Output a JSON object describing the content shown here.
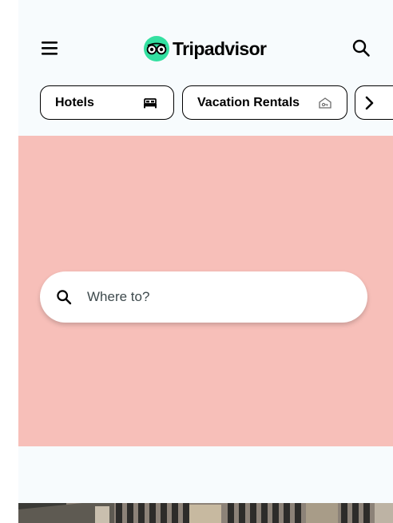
{
  "header": {
    "menu_icon": "hamburger-menu-icon",
    "brand_icon": "owl-eyes-logo-icon",
    "brand_name": "Tripadvisor",
    "search_icon": "search-icon"
  },
  "categories": [
    {
      "label": "Hotels",
      "icon": "bed-icon"
    },
    {
      "label": "Vacation Rentals",
      "icon": "house-key-icon"
    },
    {
      "label": "",
      "icon": "chevron-right-icon"
    }
  ],
  "hero": {
    "search_placeholder": "Where to?",
    "search_icon": "search-icon"
  },
  "colors": {
    "background": "#f7fbfd",
    "hero": "#f7bfb9",
    "brand_green": "#34e0a1",
    "text": "#000000"
  }
}
